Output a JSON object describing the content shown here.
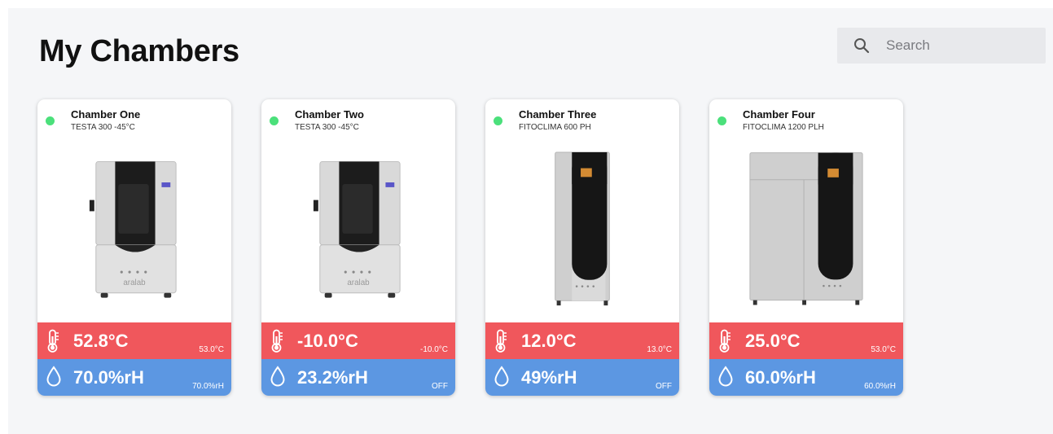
{
  "header": {
    "title": "My Chambers",
    "search_placeholder": "Search"
  },
  "colors": {
    "status_online": "#4be07b",
    "temperature_band": "#f0575c",
    "humidity_band": "#5c97e2"
  },
  "chambers": [
    {
      "name": "Chamber One",
      "model": "TESTA 300 -45°C",
      "status": "online",
      "temperature": "52.8°C",
      "temperature_setpoint": "53.0°C",
      "humidity": "70.0%rH",
      "humidity_setpoint": "70.0%rH"
    },
    {
      "name": "Chamber Two",
      "model": "TESTA 300 -45°C",
      "status": "online",
      "temperature": "-10.0°C",
      "temperature_setpoint": "-10.0°C",
      "humidity": "23.2%rH",
      "humidity_setpoint": "OFF"
    },
    {
      "name": "Chamber Three",
      "model": "FITOCLIMA 600 PH",
      "status": "online",
      "temperature": "12.0°C",
      "temperature_setpoint": "13.0°C",
      "humidity": "49%rH",
      "humidity_setpoint": "OFF"
    },
    {
      "name": "Chamber Four",
      "model": "FITOCLIMA 1200 PLH",
      "status": "online",
      "temperature": "25.0°C",
      "temperature_setpoint": "53.0°C",
      "humidity": "60.0%rH",
      "humidity_setpoint": "60.0%rH"
    }
  ],
  "icons": {
    "search": "search-icon",
    "temperature": "thermometer-icon",
    "humidity": "droplet-icon"
  }
}
